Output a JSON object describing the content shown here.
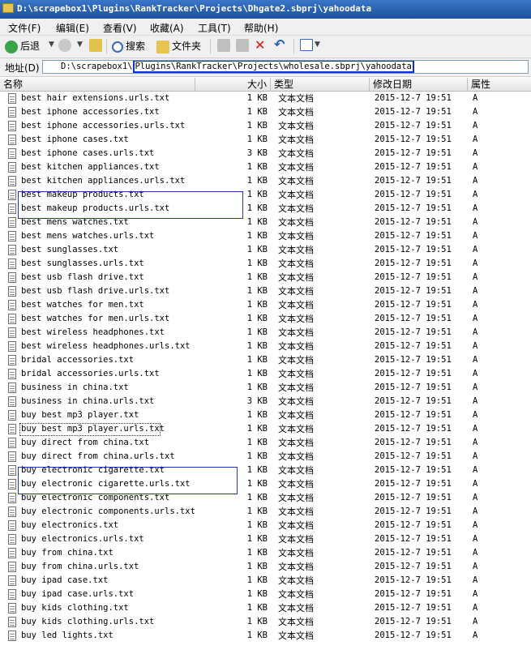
{
  "window": {
    "title": "D:\\scrapebox1\\Plugins\\RankTracker\\Projects\\Dhgate2.sbprj\\yahoodata"
  },
  "menu": [
    "文件(F)",
    "编辑(E)",
    "查看(V)",
    "收藏(A)",
    "工具(T)",
    "帮助(H)"
  ],
  "toolbar": {
    "back": "后退",
    "search": "搜索",
    "folders": "文件夹"
  },
  "address": {
    "label": "地址(D)",
    "prefix": "D:\\scrapebox1\\",
    "highlighted": "Plugins\\RankTracker\\Projects\\wholesale.sbprj\\yahoodata"
  },
  "columns": {
    "name": "名称",
    "size": "大小",
    "type": "类型",
    "modified": "修改日期",
    "attributes": "属性"
  },
  "files": [
    {
      "name": "best hair extensions.urls.txt",
      "size": "1 KB",
      "type": "文本文档",
      "modified": "2015-12-7 19:51",
      "attr": "A"
    },
    {
      "name": "best iphone accessories.txt",
      "size": "1 KB",
      "type": "文本文档",
      "modified": "2015-12-7 19:51",
      "attr": "A"
    },
    {
      "name": "best iphone accessories.urls.txt",
      "size": "1 KB",
      "type": "文本文档",
      "modified": "2015-12-7 19:51",
      "attr": "A"
    },
    {
      "name": "best iphone cases.txt",
      "size": "1 KB",
      "type": "文本文档",
      "modified": "2015-12-7 19:51",
      "attr": "A"
    },
    {
      "name": "best iphone cases.urls.txt",
      "size": "3 KB",
      "type": "文本文档",
      "modified": "2015-12-7 19:51",
      "attr": "A"
    },
    {
      "name": "best kitchen appliances.txt",
      "size": "1 KB",
      "type": "文本文档",
      "modified": "2015-12-7 19:51",
      "attr": "A"
    },
    {
      "name": "best kitchen appliances.urls.txt",
      "size": "1 KB",
      "type": "文本文档",
      "modified": "2015-12-7 19:51",
      "attr": "A"
    },
    {
      "name": "best makeup products.txt",
      "size": "1 KB",
      "type": "文本文档",
      "modified": "2015-12-7 19:51",
      "attr": "A"
    },
    {
      "name": "best makeup products.urls.txt",
      "size": "1 KB",
      "type": "文本文档",
      "modified": "2015-12-7 19:51",
      "attr": "A"
    },
    {
      "name": "best mens watches.txt",
      "size": "1 KB",
      "type": "文本文档",
      "modified": "2015-12-7 19:51",
      "attr": "A"
    },
    {
      "name": "best mens watches.urls.txt",
      "size": "1 KB",
      "type": "文本文档",
      "modified": "2015-12-7 19:51",
      "attr": "A"
    },
    {
      "name": "best sunglasses.txt",
      "size": "1 KB",
      "type": "文本文档",
      "modified": "2015-12-7 19:51",
      "attr": "A"
    },
    {
      "name": "best sunglasses.urls.txt",
      "size": "1 KB",
      "type": "文本文档",
      "modified": "2015-12-7 19:51",
      "attr": "A"
    },
    {
      "name": "best usb flash drive.txt",
      "size": "1 KB",
      "type": "文本文档",
      "modified": "2015-12-7 19:51",
      "attr": "A"
    },
    {
      "name": "best usb flash drive.urls.txt",
      "size": "1 KB",
      "type": "文本文档",
      "modified": "2015-12-7 19:51",
      "attr": "A"
    },
    {
      "name": "best watches for men.txt",
      "size": "1 KB",
      "type": "文本文档",
      "modified": "2015-12-7 19:51",
      "attr": "A"
    },
    {
      "name": "best watches for men.urls.txt",
      "size": "1 KB",
      "type": "文本文档",
      "modified": "2015-12-7 19:51",
      "attr": "A"
    },
    {
      "name": "best wireless headphones.txt",
      "size": "1 KB",
      "type": "文本文档",
      "modified": "2015-12-7 19:51",
      "attr": "A"
    },
    {
      "name": "best wireless headphones.urls.txt",
      "size": "1 KB",
      "type": "文本文档",
      "modified": "2015-12-7 19:51",
      "attr": "A"
    },
    {
      "name": "bridal accessories.txt",
      "size": "1 KB",
      "type": "文本文档",
      "modified": "2015-12-7 19:51",
      "attr": "A"
    },
    {
      "name": "bridal accessories.urls.txt",
      "size": "1 KB",
      "type": "文本文档",
      "modified": "2015-12-7 19:51",
      "attr": "A"
    },
    {
      "name": "business in china.txt",
      "size": "1 KB",
      "type": "文本文档",
      "modified": "2015-12-7 19:51",
      "attr": "A"
    },
    {
      "name": "business in china.urls.txt",
      "size": "3 KB",
      "type": "文本文档",
      "modified": "2015-12-7 19:51",
      "attr": "A"
    },
    {
      "name": "buy best mp3 player.txt",
      "size": "1 KB",
      "type": "文本文档",
      "modified": "2015-12-7 19:51",
      "attr": "A"
    },
    {
      "name": "buy best mp3 player.urls.txt",
      "size": "1 KB",
      "type": "文本文档",
      "modified": "2015-12-7 19:51",
      "attr": "A"
    },
    {
      "name": "buy direct from china.txt",
      "size": "1 KB",
      "type": "文本文档",
      "modified": "2015-12-7 19:51",
      "attr": "A"
    },
    {
      "name": "buy direct from china.urls.txt",
      "size": "1 KB",
      "type": "文本文档",
      "modified": "2015-12-7 19:51",
      "attr": "A"
    },
    {
      "name": "buy electronic cigarette.txt",
      "size": "1 KB",
      "type": "文本文档",
      "modified": "2015-12-7 19:51",
      "attr": "A"
    },
    {
      "name": "buy electronic cigarette.urls.txt",
      "size": "1 KB",
      "type": "文本文档",
      "modified": "2015-12-7 19:51",
      "attr": "A"
    },
    {
      "name": "buy electronic components.txt",
      "size": "1 KB",
      "type": "文本文档",
      "modified": "2015-12-7 19:51",
      "attr": "A"
    },
    {
      "name": "buy electronic components.urls.txt",
      "size": "1 KB",
      "type": "文本文档",
      "modified": "2015-12-7 19:51",
      "attr": "A"
    },
    {
      "name": "buy electronics.txt",
      "size": "1 KB",
      "type": "文本文档",
      "modified": "2015-12-7 19:51",
      "attr": "A"
    },
    {
      "name": "buy electronics.urls.txt",
      "size": "1 KB",
      "type": "文本文档",
      "modified": "2015-12-7 19:51",
      "attr": "A"
    },
    {
      "name": "buy from china.txt",
      "size": "1 KB",
      "type": "文本文档",
      "modified": "2015-12-7 19:51",
      "attr": "A"
    },
    {
      "name": "buy from china.urls.txt",
      "size": "1 KB",
      "type": "文本文档",
      "modified": "2015-12-7 19:51",
      "attr": "A"
    },
    {
      "name": "buy ipad case.txt",
      "size": "1 KB",
      "type": "文本文档",
      "modified": "2015-12-7 19:51",
      "attr": "A"
    },
    {
      "name": "buy ipad case.urls.txt",
      "size": "1 KB",
      "type": "文本文档",
      "modified": "2015-12-7 19:51",
      "attr": "A"
    },
    {
      "name": "buy kids clothing.txt",
      "size": "1 KB",
      "type": "文本文档",
      "modified": "2015-12-7 19:51",
      "attr": "A"
    },
    {
      "name": "buy kids clothing.urls.txt",
      "size": "1 KB",
      "type": "文本文档",
      "modified": "2015-12-7 19:51",
      "attr": "A"
    },
    {
      "name": "buy led lights.txt",
      "size": "1 KB",
      "type": "文本文档",
      "modified": "2015-12-7 19:51",
      "attr": "A"
    }
  ]
}
